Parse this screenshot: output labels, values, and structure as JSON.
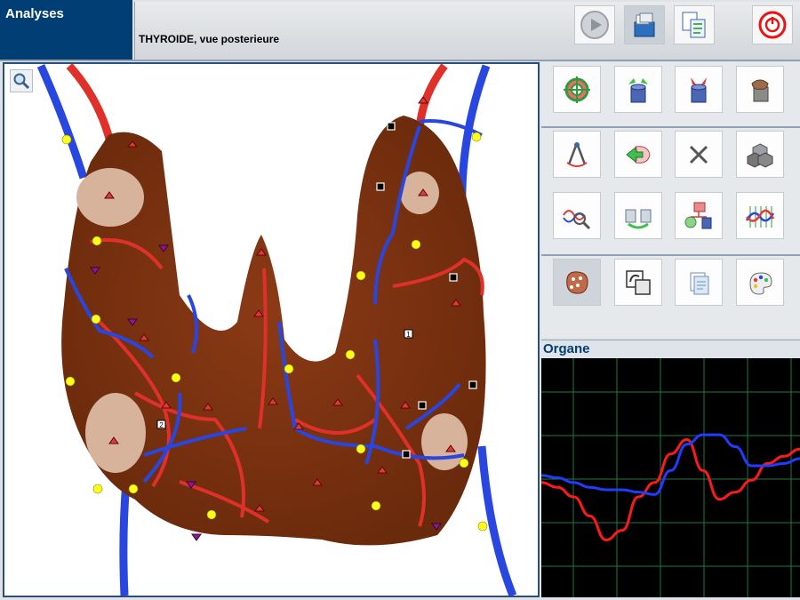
{
  "header": {
    "section": "Analyses",
    "title": "THYROIDE, vue posterieure"
  },
  "toolbar": [
    "play-icon",
    "organ-database-icon",
    "copy-document-icon",
    "power-off-icon"
  ],
  "tools": [
    [
      "target-icon",
      "bin-out-icon",
      "bin-in-icon",
      "organ-piece-icon"
    ],
    [
      "compass-icon",
      "green-arrow-organ-icon",
      "close-icon",
      "cubes-icon"
    ],
    [
      "waveform-magnifier-icon",
      "two-bins-icon",
      "organ-flow-icon",
      "spectrum-icon"
    ],
    [
      "tissue-icon",
      "edit-shapes-icon",
      "clipboard-icon",
      "palette-icon"
    ]
  ],
  "organe_panel": {
    "title": "Organe"
  },
  "markers": {
    "box_1": "1",
    "box_2": "2"
  },
  "chart_data": {
    "type": "line",
    "grid": true,
    "series": [
      {
        "color": "#ff1a1a",
        "values": [
          0.52,
          0.54,
          0.58,
          0.66,
          0.76,
          0.72,
          0.58,
          0.52,
          0.4,
          0.34,
          0.47,
          0.59,
          0.56,
          0.51,
          0.44,
          0.41,
          0.38
        ]
      },
      {
        "color": "#1f3cff",
        "values": [
          0.49,
          0.5,
          0.52,
          0.54,
          0.55,
          0.55,
          0.56,
          0.57,
          0.47,
          0.36,
          0.32,
          0.32,
          0.37,
          0.45,
          0.45,
          0.44,
          0.42
        ]
      }
    ]
  }
}
